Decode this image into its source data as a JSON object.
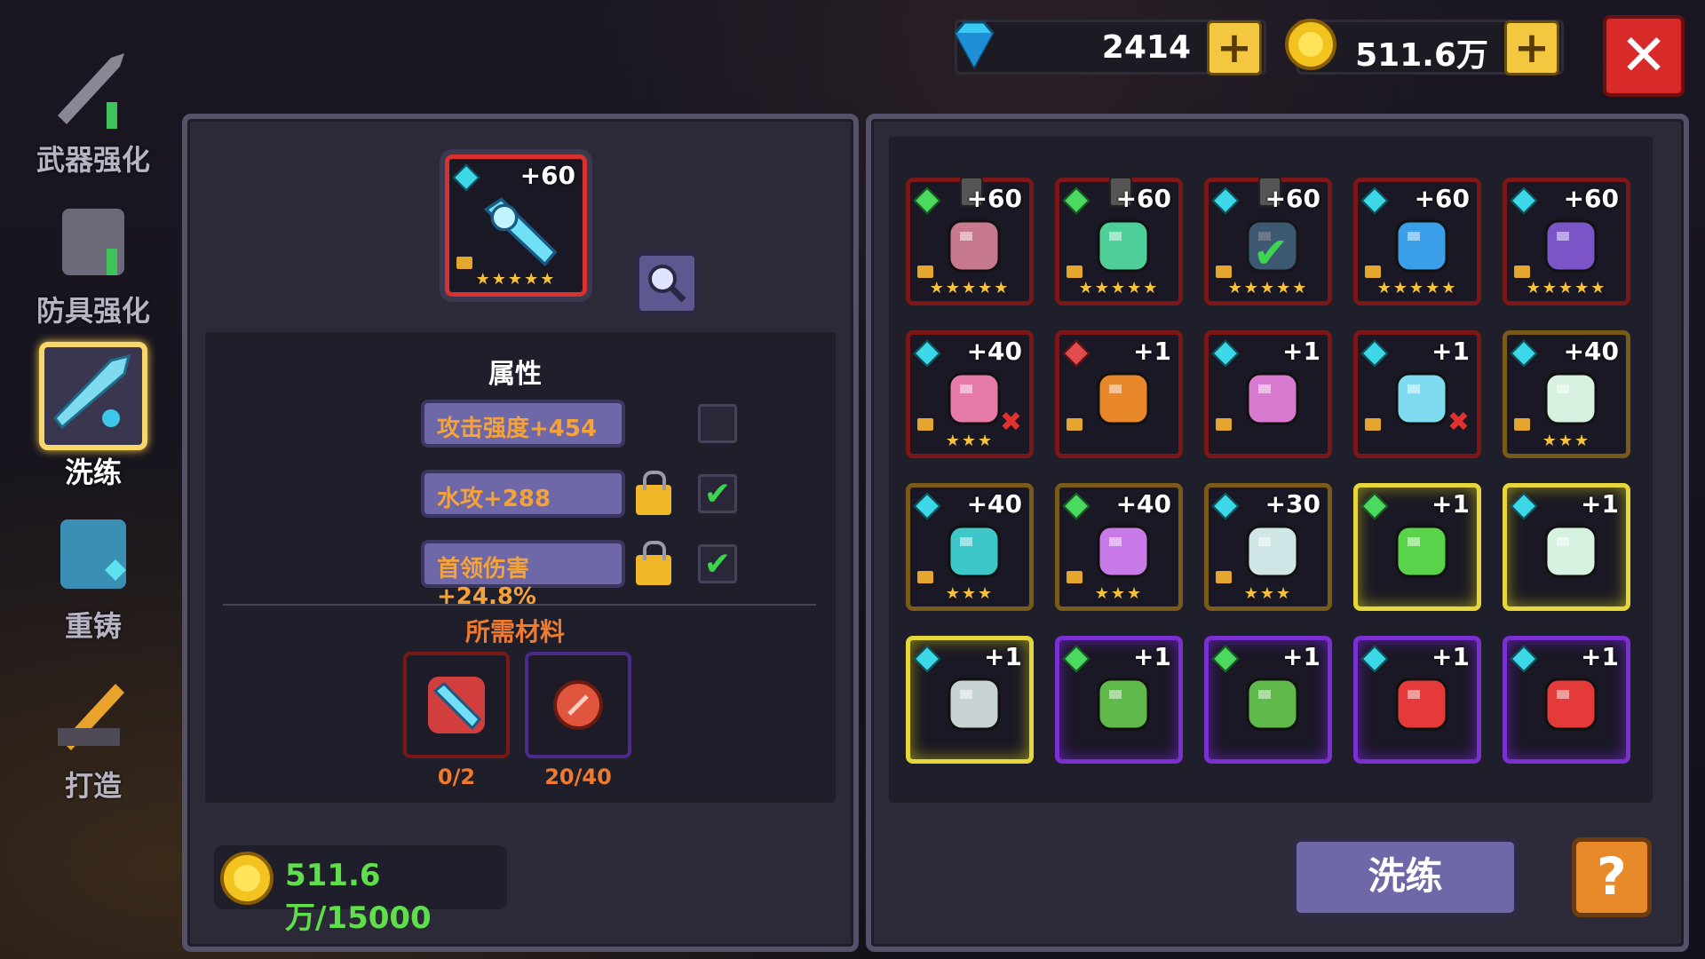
{
  "currency": {
    "gems": "2414",
    "gold": "511.6万",
    "add_label": "+"
  },
  "close_label": "✕",
  "sidebar": {
    "items": [
      {
        "label": "武器强化",
        "icon": "sword-upgrade-icon"
      },
      {
        "label": "防具强化",
        "icon": "armor-upgrade-icon"
      },
      {
        "label": "洗练",
        "icon": "refine-sword-icon",
        "active": true
      },
      {
        "label": "重铸",
        "icon": "reforge-armor-icon"
      },
      {
        "label": "打造",
        "icon": "forge-hammer-icon"
      }
    ]
  },
  "selected_item": {
    "level": "+60",
    "stars": "★★★★★",
    "icon": "ice-sword-icon"
  },
  "attributes": {
    "title": "属性",
    "rows": [
      {
        "text": "攻击强度+454",
        "locked": false,
        "checked": false
      },
      {
        "text": "水攻+288",
        "locked": true,
        "checked": true
      },
      {
        "text": "首领伤害+24.8%",
        "locked": true,
        "checked": true
      }
    ],
    "check_mark": "✔"
  },
  "materials": {
    "title": "所需材料",
    "items": [
      {
        "icon": "ice-sword-material-icon",
        "count": "0/2"
      },
      {
        "icon": "red-stone-material-icon",
        "count": "20/40"
      }
    ]
  },
  "cost": {
    "text": "511.6万/15000"
  },
  "inventory": [
    {
      "level": "+60",
      "stars": "★★★★★",
      "gem": "green",
      "frame": "red",
      "icon": "pink-golem-pet-icon",
      "pinned": true
    },
    {
      "level": "+60",
      "stars": "★★★★★",
      "gem": "green",
      "frame": "red",
      "icon": "jade-sword-icon",
      "pinned": true
    },
    {
      "level": "+60",
      "stars": "★★★★★",
      "gem": "blue",
      "frame": "red",
      "icon": "crossbow-icon",
      "pinned": true,
      "equipped": true
    },
    {
      "level": "+60",
      "stars": "★★★★★",
      "gem": "blue",
      "frame": "red",
      "icon": "blue-fish-pet-icon"
    },
    {
      "level": "+60",
      "stars": "★★★★★",
      "gem": "blue",
      "frame": "red",
      "icon": "purple-gauntlet-icon"
    },
    {
      "level": "+40",
      "stars": "★★★",
      "gem": "blue",
      "frame": "red",
      "icon": "pink-scythe-icon",
      "cross": true
    },
    {
      "level": "+1",
      "stars": "",
      "gem": "red",
      "frame": "red",
      "icon": "lantern-icon"
    },
    {
      "level": "+1",
      "stars": "",
      "gem": "blue",
      "frame": "red",
      "icon": "pink-crystal-icon"
    },
    {
      "level": "+1",
      "stars": "",
      "gem": "blue",
      "frame": "red",
      "icon": "ice-trident-icon",
      "cross": true
    },
    {
      "level": "+40",
      "stars": "★★★",
      "gem": "blue",
      "frame": "gold",
      "icon": "white-dragon-icon"
    },
    {
      "level": "+40",
      "stars": "★★★",
      "gem": "blue",
      "frame": "gold",
      "icon": "ice-shark-icon"
    },
    {
      "level": "+40",
      "stars": "★★★",
      "gem": "green",
      "frame": "gold",
      "icon": "purple-scythe-icon"
    },
    {
      "level": "+30",
      "stars": "★★★",
      "gem": "blue",
      "frame": "gold",
      "icon": "ice-dagger-icon"
    },
    {
      "level": "+1",
      "stars": "",
      "gem": "green",
      "frame": "yellow",
      "icon": "green-cannon-icon"
    },
    {
      "level": "+1",
      "stars": "",
      "gem": "blue",
      "frame": "yellow",
      "icon": "white-dragon-icon"
    },
    {
      "level": "+1",
      "stars": "",
      "gem": "blue",
      "frame": "yellow",
      "icon": "steel-dagger-icon"
    },
    {
      "level": "+1",
      "stars": "",
      "gem": "green",
      "frame": "purple",
      "icon": "cactus-pet-icon"
    },
    {
      "level": "+1",
      "stars": "",
      "gem": "green",
      "frame": "purple",
      "icon": "cactus-pet-icon"
    },
    {
      "level": "+1",
      "stars": "",
      "gem": "blue",
      "frame": "purple",
      "icon": "fire-extinguisher-icon"
    },
    {
      "level": "+1",
      "stars": "",
      "gem": "blue",
      "frame": "purple",
      "icon": "fire-extinguisher-icon"
    }
  ],
  "buttons": {
    "refine": "洗练",
    "help": "?"
  },
  "colors": {
    "accent_orange": "#f5a238",
    "check_green": "#3cd54e",
    "cost_green": "#5fe04a",
    "close_red": "#d92a2a"
  }
}
